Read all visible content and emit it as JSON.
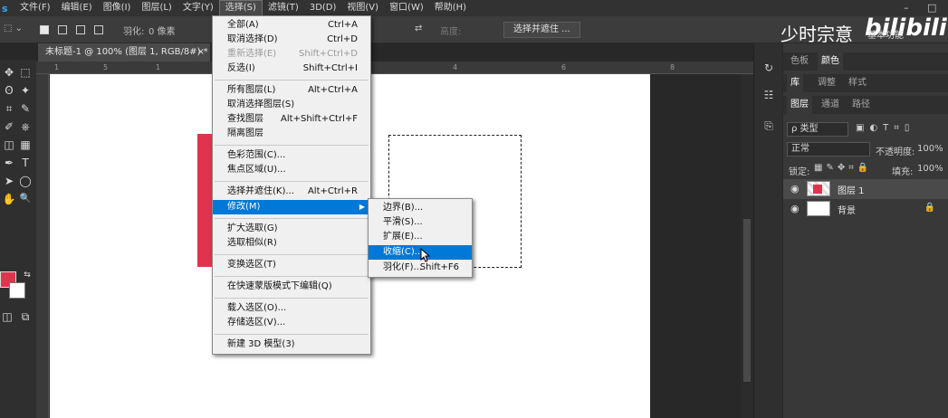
{
  "app": {
    "logo": "s"
  },
  "menubar": {
    "items": [
      "文件(F)",
      "编辑(E)",
      "图像(I)",
      "图层(L)",
      "文字(Y)",
      "选择(S)",
      "滤镜(T)",
      "3D(D)",
      "视图(V)",
      "窗口(W)",
      "帮助(H)"
    ],
    "active_index": 5,
    "window_controls": {
      "minimize": "–",
      "restore": "□"
    }
  },
  "options_bar": {
    "feather_label": "羽化:",
    "feather_value": "0 像素",
    "height_label": "高度:",
    "select_and_mask_button": "选择并遮住 ..."
  },
  "watermark": {
    "text": "少时宗意",
    "brand": "bilibili",
    "extra": "基本功能"
  },
  "document_tab": {
    "title": "未标题-1 @ 100% (图层 1, RGB/8#) *",
    "close": "×"
  },
  "ruler": {
    "ticks": [
      "1",
      "5",
      "1",
      "4",
      "6",
      "8"
    ]
  },
  "tools": [
    "move-tool-icon",
    "marquee-tool-icon",
    "lasso-tool-icon",
    "magic-wand-icon",
    "crop-tool-icon",
    "eyedropper-icon",
    "brush-tool-icon",
    "stamp-tool-icon",
    "eraser-tool-icon",
    "gradient-tool-icon",
    "pen-tool-icon",
    "type-tool-icon",
    "path-select-icon",
    "shape-tool-icon",
    "hand-tool-icon",
    "zoom-tool-icon"
  ],
  "tool_glyphs": [
    "✥",
    "⬚",
    "ʘ",
    "✦",
    "⌗",
    "✎",
    "✐",
    "⎈",
    "◫",
    "▦",
    "✒",
    "T",
    "➤",
    "◯",
    "✋",
    "🔍"
  ],
  "colors": {
    "foreground": "#e0334e",
    "background": "#ffffff",
    "accent": "#0078d7"
  },
  "select_menu": {
    "items": [
      {
        "label": "全部(A)",
        "shortcut": "Ctrl+A"
      },
      {
        "label": "取消选择(D)",
        "shortcut": "Ctrl+D"
      },
      {
        "label": "重新选择(E)",
        "shortcut": "Shift+Ctrl+D",
        "disabled": true
      },
      {
        "label": "反选(I)",
        "shortcut": "Shift+Ctrl+I"
      },
      {
        "label": "所有图层(L)",
        "shortcut": "Alt+Ctrl+A"
      },
      {
        "label": "取消选择图层(S)",
        "shortcut": ""
      },
      {
        "label": "查找图层",
        "shortcut": "Alt+Shift+Ctrl+F"
      },
      {
        "label": "隔离图层",
        "shortcut": ""
      },
      {
        "label": "色彩范围(C)...",
        "shortcut": ""
      },
      {
        "label": "焦点区域(U)...",
        "shortcut": ""
      },
      {
        "label": "选择并遮住(K)...",
        "shortcut": "Alt+Ctrl+R"
      },
      {
        "label": "修改(M)",
        "shortcut": "",
        "highlighted": true,
        "submenu": true
      },
      {
        "label": "扩大选取(G)",
        "shortcut": ""
      },
      {
        "label": "选取相似(R)",
        "shortcut": ""
      },
      {
        "label": "变换选区(T)",
        "shortcut": ""
      },
      {
        "label": "在快速蒙版模式下编辑(Q)",
        "shortcut": ""
      },
      {
        "label": "载入选区(O)...",
        "shortcut": ""
      },
      {
        "label": "存储选区(V)...",
        "shortcut": ""
      },
      {
        "label": "新建 3D 模型(3)",
        "shortcut": ""
      }
    ]
  },
  "modify_submenu": {
    "items": [
      {
        "label": "边界(B)...",
        "shortcut": ""
      },
      {
        "label": "平滑(S)...",
        "shortcut": ""
      },
      {
        "label": "扩展(E)...",
        "shortcut": ""
      },
      {
        "label": "收缩(C)...",
        "shortcut": "",
        "highlighted": true
      },
      {
        "label": "羽化(F)...",
        "shortcut": "Shift+F6"
      }
    ]
  },
  "panels": {
    "group1_tabs": [
      "色板",
      "颜色"
    ],
    "group2_tabs": [
      "库",
      "调整",
      "样式"
    ],
    "group3_tabs": [
      "图层",
      "通道",
      "路径"
    ],
    "filter_kind": "ρ 类型",
    "blend_mode": "正常",
    "opacity_label": "不透明度:",
    "opacity_value": "100%",
    "lock_label": "锁定:",
    "fill_label": "填充:",
    "fill_value": "100%",
    "layers": [
      {
        "name": "图层 1",
        "selected": true
      },
      {
        "name": "背景",
        "selected": false,
        "locked": true
      }
    ]
  }
}
